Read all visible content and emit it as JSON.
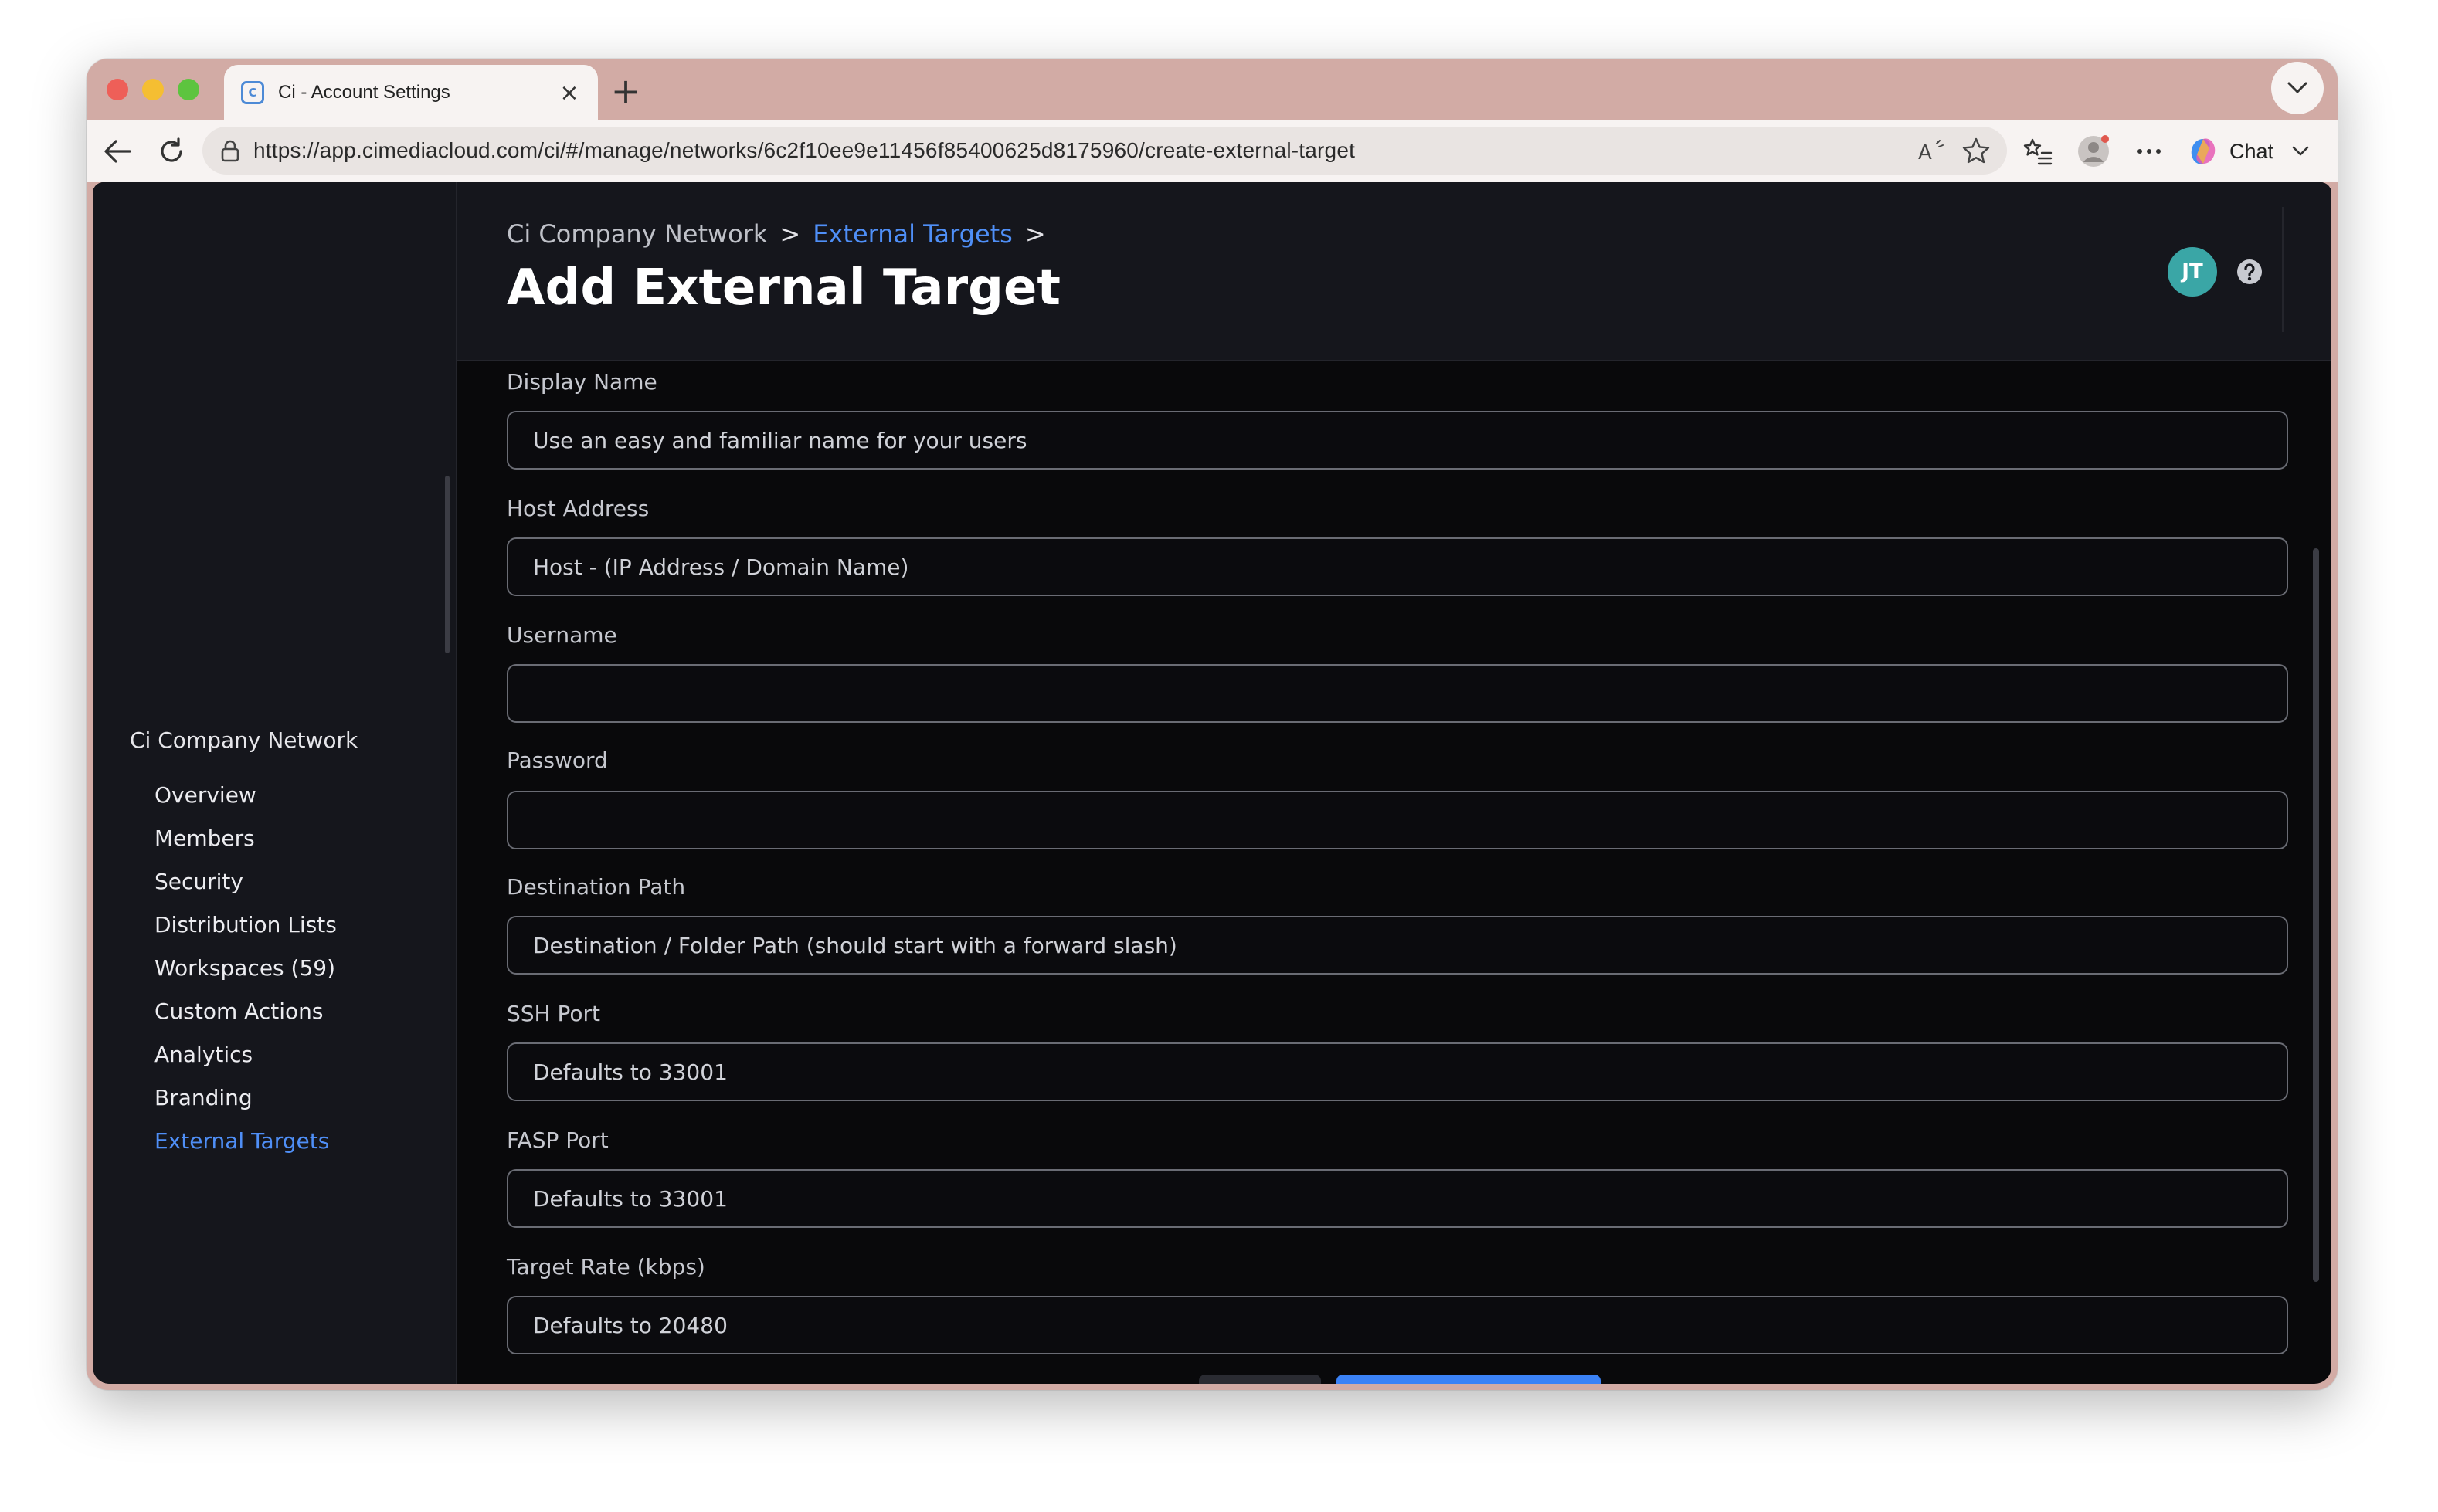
{
  "browser": {
    "tab_title": "Ci - Account Settings",
    "tab_favicon": "C",
    "url": "https://app.cimediacloud.com/ci/#/manage/networks/6c2f10ee9e11456f85400625d8175960/create-external-target",
    "chat_label": "Chat"
  },
  "sidebar": {
    "section_title": "Ci Company Network",
    "items": [
      {
        "label": "Overview"
      },
      {
        "label": "Members"
      },
      {
        "label": "Security"
      },
      {
        "label": "Distribution Lists"
      },
      {
        "label": "Workspaces (59)"
      },
      {
        "label": "Custom Actions"
      },
      {
        "label": "Analytics"
      },
      {
        "label": "Branding"
      },
      {
        "label": "External Targets",
        "active": true
      }
    ]
  },
  "header": {
    "breadcrumb": [
      {
        "label": "Ci Company Network"
      },
      {
        "label": "External Targets"
      }
    ],
    "separator": ">",
    "title": "Add External Target",
    "avatar_initials": "JT"
  },
  "form": {
    "fields": [
      {
        "label": "Display Name",
        "placeholder": "Use an easy and familiar name for your users",
        "value": ""
      },
      {
        "label": "Host Address",
        "placeholder": "Host - (IP Address / Domain Name)",
        "value": ""
      },
      {
        "label": "Username",
        "placeholder": "",
        "value": ""
      },
      {
        "label": "Password",
        "placeholder": "",
        "value": ""
      },
      {
        "label": "Destination Path",
        "placeholder": "Destination / Folder Path (should start with a forward slash)",
        "value": ""
      },
      {
        "label": "SSH Port",
        "placeholder": "Defaults to 33001",
        "value": ""
      },
      {
        "label": "FASP Port",
        "placeholder": "Defaults to 33001",
        "value": ""
      },
      {
        "label": "Target Rate (kbps)",
        "placeholder": "Defaults to 20480",
        "value": ""
      }
    ]
  },
  "colors": {
    "accent": "#4f8ff7",
    "primary_button": "#3b82f6",
    "avatar": "#3aa6a6",
    "browser_frame": "#d2aba5"
  }
}
